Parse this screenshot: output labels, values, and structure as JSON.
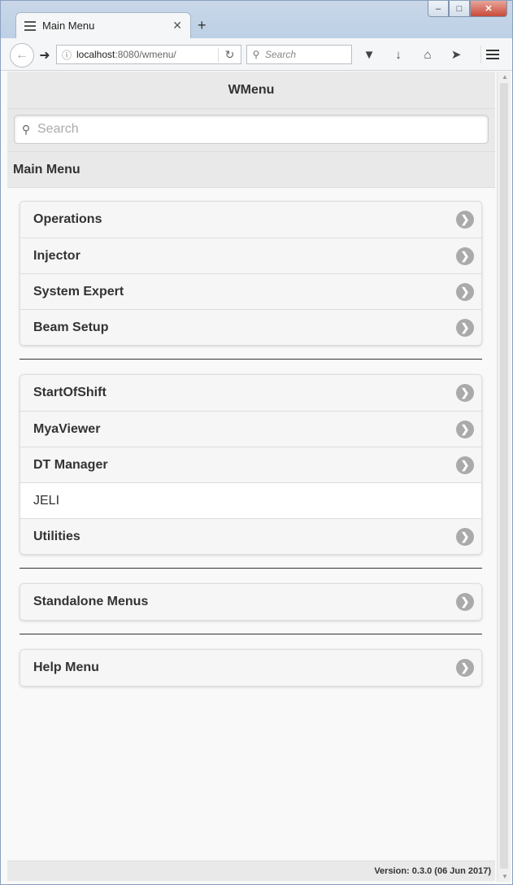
{
  "browser": {
    "tab_title": "Main Menu",
    "new_tab_label": "+",
    "url_host": "localhost",
    "url_path": ":8080/wmenu/",
    "search_placeholder": "Search"
  },
  "page": {
    "title": "WMenu",
    "search_placeholder": "Search",
    "section_title": "Main Menu",
    "groups": [
      {
        "items": [
          {
            "label": "Operations",
            "chevron": true
          },
          {
            "label": "Injector",
            "chevron": true
          },
          {
            "label": "System Expert",
            "chevron": true
          },
          {
            "label": "Beam Setup",
            "chevron": true
          }
        ]
      },
      {
        "items": [
          {
            "label": "StartOfShift",
            "chevron": true
          },
          {
            "label": "MyaViewer",
            "chevron": true
          },
          {
            "label": "DT Manager",
            "chevron": true
          },
          {
            "label": "JELI",
            "chevron": false
          },
          {
            "label": "Utilities",
            "chevron": true
          }
        ]
      },
      {
        "items": [
          {
            "label": "Standalone Menus",
            "chevron": true
          }
        ]
      },
      {
        "items": [
          {
            "label": "Help Menu",
            "chevron": true
          }
        ]
      }
    ],
    "version": "Version: 0.3.0 (06 Jun 2017)"
  },
  "colors": {
    "chevron": "#aaaaaa",
    "header_bg": "#e9e9e9",
    "divider": "#333333"
  }
}
